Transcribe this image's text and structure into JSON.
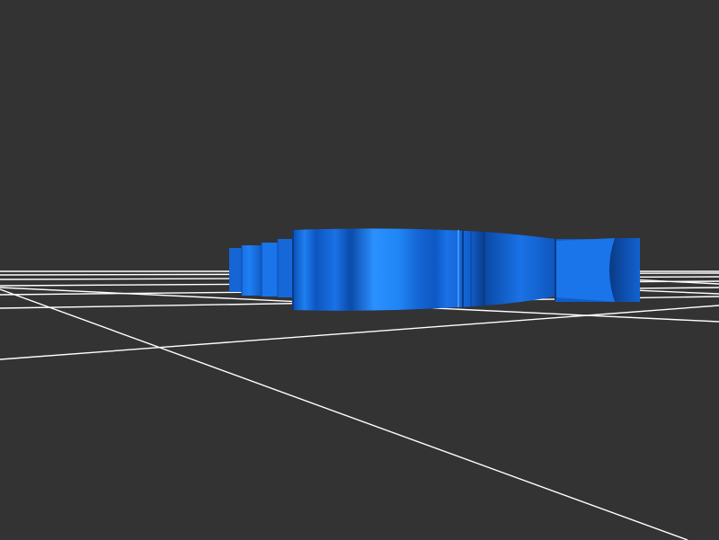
{
  "viewport": {
    "background_color": "#333333",
    "grid_color": "#ffffff",
    "model_color": "#1a72e6",
    "model_highlight_color": "#2b90ff",
    "model_shadow_color": "#0a3a85",
    "grid_visible": true
  }
}
